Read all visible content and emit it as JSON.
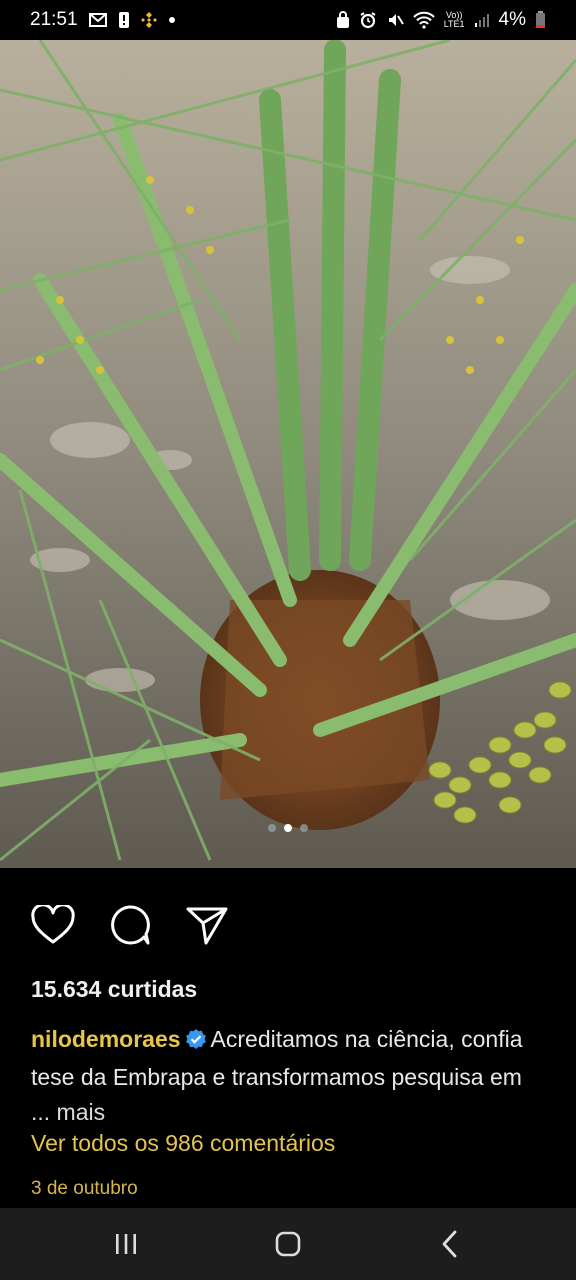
{
  "status_bar": {
    "time": "21:51",
    "battery": "4%",
    "network_label_top": "Vo))",
    "network_label_bottom": "LTE1"
  },
  "post": {
    "likes": "15.634 curtidas",
    "username": "nilodemoraes",
    "caption_line1": "Acreditamos na ciência, confia",
    "caption_line2": "tese da Embrapa e transformamos pesquisa em",
    "more": "... mais",
    "view_comments": "Ver todos os 986 comentários",
    "date": "3 de outubro",
    "carousel": {
      "total": 3,
      "active": 2
    }
  },
  "colors": {
    "username": "#e6c54a",
    "comments": "#e4c44e",
    "verified": "#3897f0",
    "navbar": "#1d1d1d"
  },
  "icons": [
    "heart-icon",
    "comment-icon",
    "share-icon",
    "recent-apps-icon",
    "home-icon",
    "back-icon"
  ]
}
